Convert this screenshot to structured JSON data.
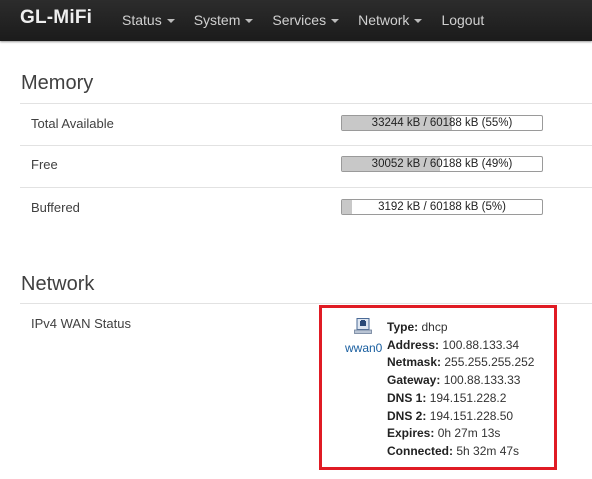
{
  "nav": {
    "brand": "GL-MiFi",
    "menu": [
      "Status",
      "System",
      "Services",
      "Network",
      "Logout"
    ]
  },
  "memory": {
    "title": "Memory",
    "rows": [
      {
        "label": "Total Available",
        "bar_text": "33244 kB / 60188 kB (55%)",
        "percent": 55
      },
      {
        "label": "Free",
        "bar_text": "30052 kB / 60188 kB (49%)",
        "percent": 49
      },
      {
        "label": "Buffered",
        "bar_text": "3192 kB / 60188 kB (5%)",
        "percent": 5
      }
    ]
  },
  "network": {
    "title": "Network",
    "wan_label": "IPv4 WAN Status",
    "interface": {
      "name": "wwan0",
      "icon": "ethernet-port-icon"
    },
    "details": [
      {
        "key": "Type:",
        "value": "dhcp"
      },
      {
        "key": "Address:",
        "value": "100.88.133.34"
      },
      {
        "key": "Netmask:",
        "value": "255.255.255.252"
      },
      {
        "key": "Gateway:",
        "value": "100.88.133.33"
      },
      {
        "key": "DNS 1:",
        "value": "194.151.228.2"
      },
      {
        "key": "DNS 2:",
        "value": "194.151.228.50"
      },
      {
        "key": "Expires:",
        "value": "0h 27m 13s"
      },
      {
        "key": "Connected:",
        "value": "5h 32m 47s"
      }
    ]
  },
  "colors": {
    "topbar": "#1f1f1f",
    "highlight": "#e01b24",
    "link": "#1a5fa0",
    "bar_fill": "#c8c8c8"
  }
}
